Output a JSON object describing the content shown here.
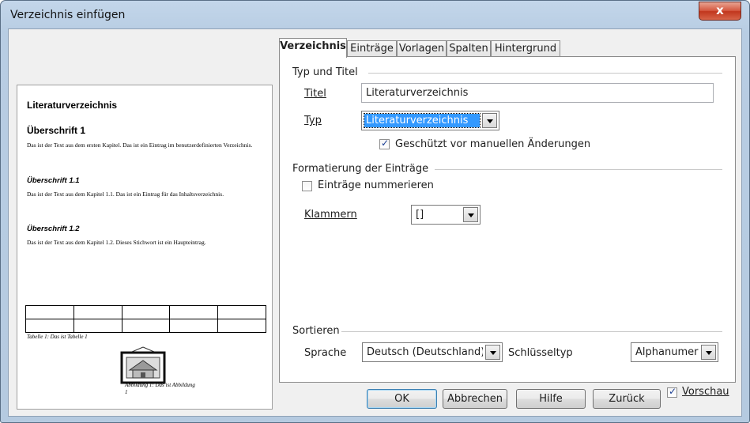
{
  "window": {
    "title": "Verzeichnis einfügen",
    "close_glyph": "x"
  },
  "preview": {
    "heading_main": "Literaturverzeichnis",
    "heading_1": "Überschrift 1",
    "text_1": "Das ist der Text aus dem ersten Kapitel. Das ist ein Eintrag im benutzerdefinierten Verzeichnis.",
    "heading_11": "Überschrift 1.1",
    "text_11": "Das ist der Text aus dem Kapitel 1.1. Das ist ein Eintrag für das Inhaltsverzeichnis.",
    "heading_12": "Überschrift 1.2",
    "text_12": "Das ist der Text aus dem Kapitel 1.2. Dieses Stichwort ist ein Haupteintrag.",
    "table_caption": "Tabelle 1: Das ist Tabelle 1",
    "figure_caption": "Abbildung 1: Das ist Abbildung 1",
    "picture_icon": "framed-house-picture-icon"
  },
  "tabs": [
    "Verzeichnis",
    "Einträge",
    "Vorlagen",
    "Spalten",
    "Hintergrund"
  ],
  "active_tab": "Verzeichnis",
  "type_title": {
    "section": "Typ und Titel",
    "title_label": "Titel",
    "title_value": "Literaturverzeichnis",
    "type_label": "Typ",
    "type_value": "Literaturverzeichnis",
    "protected_label": "Geschützt vor manuellen Änderungen",
    "protected_checked": true
  },
  "formatting": {
    "section": "Formatierung der Einträge",
    "number_entries_label": "Einträge nummerieren",
    "number_entries_checked": false,
    "brackets_label": "Klammern",
    "brackets_value": "[]"
  },
  "sort": {
    "section": "Sortieren",
    "language_label": "Sprache",
    "language_value": "Deutsch (Deutschland)",
    "key_type_label": "Schlüsseltyp",
    "key_type_value": "Alphanumeris"
  },
  "buttons": {
    "ok": "OK",
    "cancel": "Abbrechen",
    "help": "Hilfe",
    "back": "Zurück"
  },
  "preview_toggle": {
    "label": "Vorschau",
    "checked": true
  },
  "colors": {
    "selection": "#3399ff",
    "window_frame": "#b8cde3",
    "close_button": "#c1361d"
  }
}
